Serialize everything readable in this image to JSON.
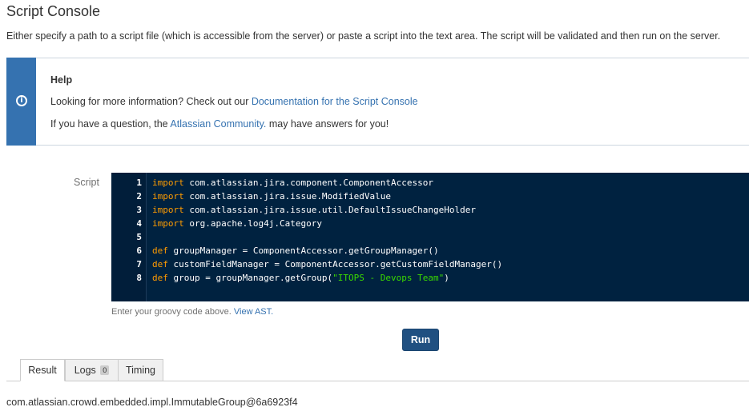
{
  "page": {
    "title": "Script Console",
    "description": "Either specify a path to a script file (which is accessible from the server) or paste a script into the text area. The script will be validated and then run on the server."
  },
  "help": {
    "title": "Help",
    "line1_prefix": "Looking for more information? Check out our ",
    "line1_link": "Documentation for the Script Console",
    "line2_prefix": "If you have a question, the ",
    "line2_link": "Atlassian Community.",
    "line2_suffix": " may have answers for you!",
    "icon": "info-icon",
    "accent_color": "#3572b0"
  },
  "editor": {
    "label": "Script",
    "line_numbers": [
      "1",
      "2",
      "3",
      "4",
      "5",
      "6",
      "7",
      "8"
    ],
    "lines": [
      {
        "kw": "import",
        "rest": " com.atlassian.jira.component.ComponentAccessor",
        "str": "",
        "tail": ""
      },
      {
        "kw": "import",
        "rest": " com.atlassian.jira.issue.ModifiedValue",
        "str": "",
        "tail": ""
      },
      {
        "kw": "import",
        "rest": " com.atlassian.jira.issue.util.DefaultIssueChangeHolder",
        "str": "",
        "tail": ""
      },
      {
        "kw": "import",
        "rest": " org.apache.log4j.Category",
        "str": "",
        "tail": ""
      },
      {
        "kw": "",
        "rest": "",
        "str": "",
        "tail": ""
      },
      {
        "kw": "def",
        "rest": " groupManager = ComponentAccessor.getGroupManager()",
        "str": "",
        "tail": ""
      },
      {
        "kw": "def",
        "rest": " customFieldManager = ComponentAccessor.getCustomFieldManager()",
        "str": "",
        "tail": ""
      },
      {
        "kw": "def",
        "rest": " group = groupManager.getGroup(",
        "str": "\"ITOPS - Devops Team\"",
        "tail": ")"
      }
    ],
    "hint_prefix": "Enter your groovy code above. ",
    "hint_link": "View AST.",
    "background_color": "#002240"
  },
  "run_button": {
    "label": "Run",
    "color": "#205081"
  },
  "tabs": [
    {
      "label": "Result"
    },
    {
      "label": "Logs",
      "count": "0"
    },
    {
      "label": "Timing"
    }
  ],
  "result": {
    "text": "com.atlassian.crowd.embedded.impl.ImmutableGroup@6a6923f4"
  }
}
